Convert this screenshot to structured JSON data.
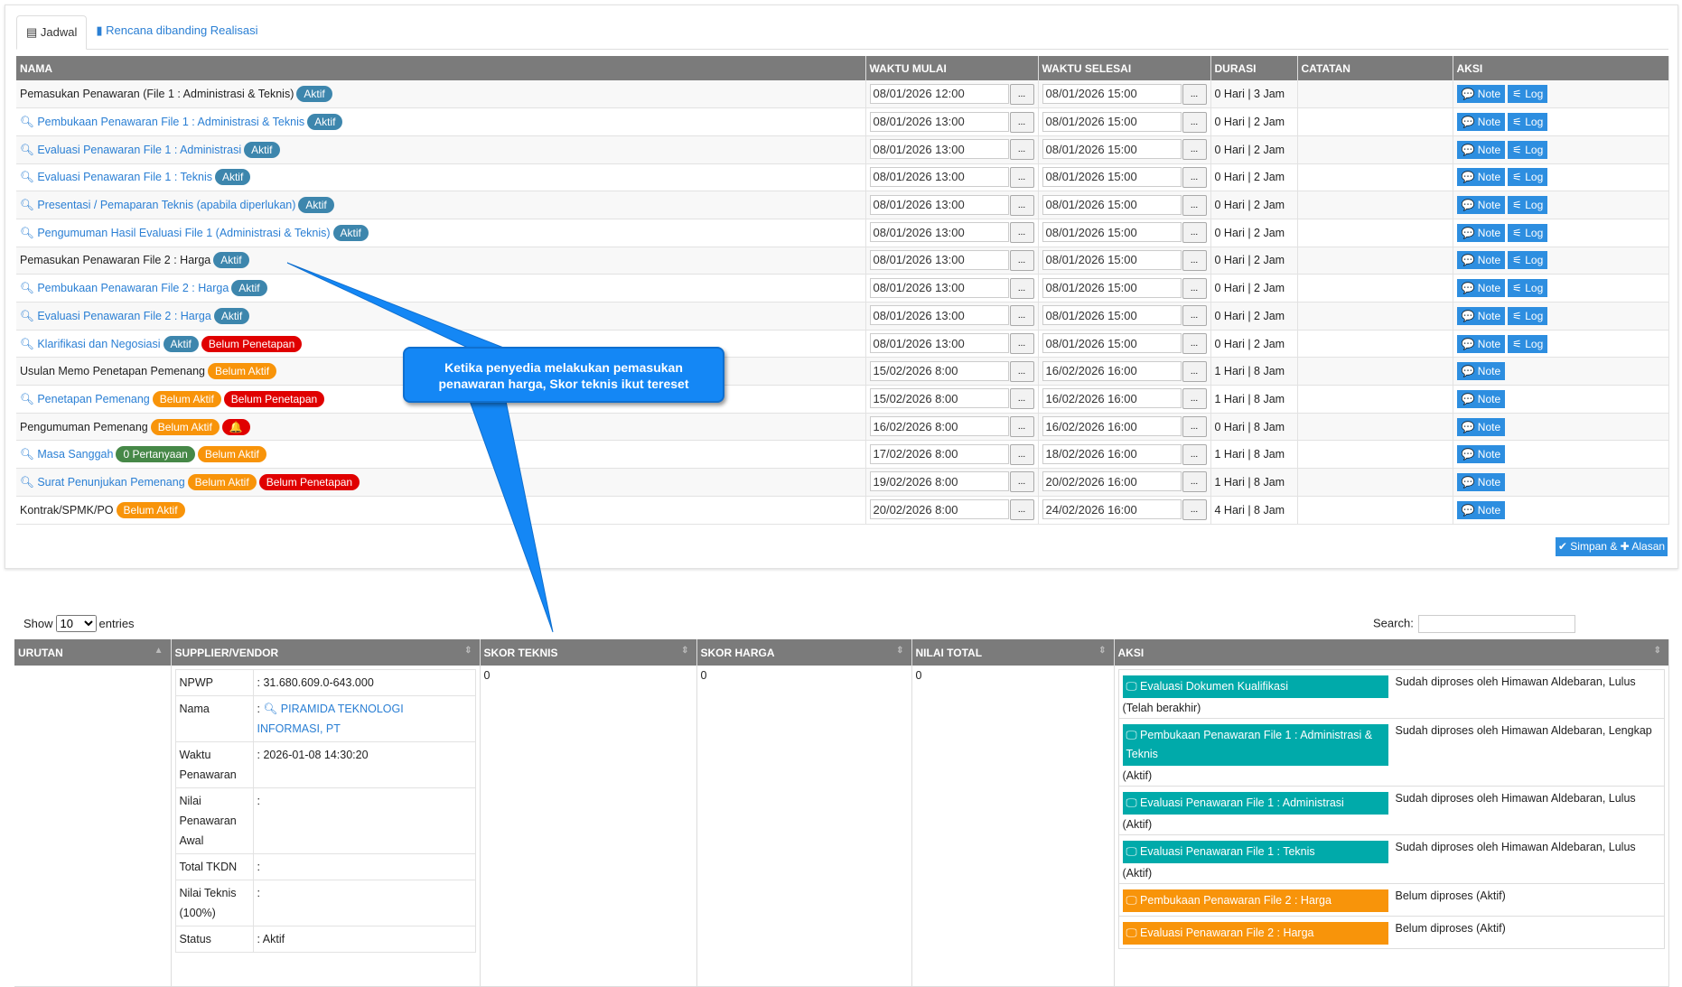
{
  "tabs": {
    "jadwal": "Jadwal",
    "rencana": "Rencana dibanding Realisasi"
  },
  "schedule": {
    "headers": [
      "NAMA",
      "WAKTU MULAI",
      "WAKTU SELESAI",
      "DURASI",
      "CATATAN",
      "AKSI"
    ],
    "note_label": "Note",
    "log_label": "Log",
    "picker_label": "...",
    "rows": [
      {
        "name": "Pemasukan Penawaran (File 1 : Administrasi & Teknis)",
        "link": false,
        "badges": [
          {
            "t": "Aktif",
            "c": "aktif"
          }
        ],
        "start": "08/01/2026 12:00",
        "end": "08/01/2026 15:00",
        "dur": "0 Hari | 3 Jam",
        "log": true
      },
      {
        "name": "Pembukaan Penawaran File 1 : Administrasi & Teknis",
        "link": true,
        "badges": [
          {
            "t": "Aktif",
            "c": "aktif"
          }
        ],
        "start": "08/01/2026 13:00",
        "end": "08/01/2026 15:00",
        "dur": "0 Hari | 2 Jam",
        "log": true
      },
      {
        "name": "Evaluasi Penawaran File 1 : Administrasi",
        "link": true,
        "badges": [
          {
            "t": "Aktif",
            "c": "aktif"
          }
        ],
        "start": "08/01/2026 13:00",
        "end": "08/01/2026 15:00",
        "dur": "0 Hari | 2 Jam",
        "log": true
      },
      {
        "name": "Evaluasi Penawaran File 1 : Teknis",
        "link": true,
        "badges": [
          {
            "t": "Aktif",
            "c": "aktif"
          }
        ],
        "start": "08/01/2026 13:00",
        "end": "08/01/2026 15:00",
        "dur": "0 Hari | 2 Jam",
        "log": true
      },
      {
        "name": "Presentasi / Pemaparan Teknis (apabila diperlukan)",
        "link": true,
        "badges": [
          {
            "t": "Aktif",
            "c": "aktif"
          }
        ],
        "start": "08/01/2026 13:00",
        "end": "08/01/2026 15:00",
        "dur": "0 Hari | 2 Jam",
        "log": true
      },
      {
        "name": "Pengumuman Hasil Evaluasi File 1 (Administrasi & Teknis)",
        "link": true,
        "badges": [
          {
            "t": "Aktif",
            "c": "aktif"
          }
        ],
        "start": "08/01/2026 13:00",
        "end": "08/01/2026 15:00",
        "dur": "0 Hari | 2 Jam",
        "log": true
      },
      {
        "name": "Pemasukan Penawaran File 2 : Harga",
        "link": false,
        "badges": [
          {
            "t": "Aktif",
            "c": "aktif"
          }
        ],
        "start": "08/01/2026 13:00",
        "end": "08/01/2026 15:00",
        "dur": "0 Hari | 2 Jam",
        "log": true
      },
      {
        "name": "Pembukaan Penawaran File 2 : Harga",
        "link": true,
        "badges": [
          {
            "t": "Aktif",
            "c": "aktif"
          }
        ],
        "start": "08/01/2026 13:00",
        "end": "08/01/2026 15:00",
        "dur": "0 Hari | 2 Jam",
        "log": true
      },
      {
        "name": "Evaluasi Penawaran File 2 : Harga",
        "link": true,
        "badges": [
          {
            "t": "Aktif",
            "c": "aktif"
          }
        ],
        "start": "08/01/2026 13:00",
        "end": "08/01/2026 15:00",
        "dur": "0 Hari | 2 Jam",
        "log": true
      },
      {
        "name": "Klarifikasi dan Negosiasi",
        "link": true,
        "badges": [
          {
            "t": "Aktif",
            "c": "aktif"
          },
          {
            "t": "Belum Penetapan",
            "c": "red"
          }
        ],
        "start": "08/01/2026 13:00",
        "end": "08/01/2026 15:00",
        "dur": "0 Hari | 2 Jam",
        "log": true
      },
      {
        "name": "Usulan Memo Penetapan Pemenang",
        "link": false,
        "badges": [
          {
            "t": "Belum Aktif",
            "c": "orange"
          }
        ],
        "start": "15/02/2026 8:00",
        "end": "16/02/2026 16:00",
        "dur": "1 Hari | 8 Jam",
        "log": false
      },
      {
        "name": "Penetapan Pemenang",
        "link": true,
        "badges": [
          {
            "t": "Belum Aktif",
            "c": "orange"
          },
          {
            "t": "Belum Penetapan",
            "c": "red"
          }
        ],
        "start": "15/02/2026 8:00",
        "end": "16/02/2026 16:00",
        "dur": "1 Hari | 8 Jam",
        "log": false
      },
      {
        "name": "Pengumuman Pemenang",
        "link": false,
        "badges": [
          {
            "t": "Belum Aktif",
            "c": "orange"
          },
          {
            "t": "🔔",
            "c": "red"
          }
        ],
        "start": "16/02/2026 8:00",
        "end": "16/02/2026 16:00",
        "dur": "0 Hari | 8 Jam",
        "log": false
      },
      {
        "name": "Masa Sanggah",
        "link": true,
        "badges": [
          {
            "t": "0 Pertanyaan",
            "c": "green"
          },
          {
            "t": "Belum Aktif",
            "c": "orange"
          }
        ],
        "start": "17/02/2026 8:00",
        "end": "18/02/2026 16:00",
        "dur": "1 Hari | 8 Jam",
        "log": false
      },
      {
        "name": "Surat Penunjukan Pemenang",
        "link": true,
        "badges": [
          {
            "t": "Belum Aktif",
            "c": "orange"
          },
          {
            "t": "Belum Penetapan",
            "c": "red"
          }
        ],
        "start": "19/02/2026 8:00",
        "end": "20/02/2026 16:00",
        "dur": "1 Hari | 8 Jam",
        "log": false
      },
      {
        "name": "Kontrak/SPMK/PO",
        "link": false,
        "badges": [
          {
            "t": "Belum Aktif",
            "c": "orange"
          }
        ],
        "start": "20/02/2026 8:00",
        "end": "24/02/2026 16:00",
        "dur": "4 Hari | 8 Jam",
        "log": false
      }
    ],
    "save_label": "Simpan & ✚ Alasan"
  },
  "colors": {
    "aktif": "#3d86ad",
    "orange": "#f8940a",
    "red": "#e00000",
    "green": "#468847",
    "teal": "#00aaaa",
    "blue": "#2d8ee0"
  },
  "callout": {
    "text1": "Ketika penyedia melakukan pemasukan",
    "text2": "penawaran harga, Skor teknis ikut tereset"
  },
  "results": {
    "show": "Show",
    "entries": "entries",
    "length": "10",
    "search": "Search:",
    "headers": [
      "URUTAN",
      "SUPPLIER/VENDOR",
      "SKOR TEKNIS",
      "SKOR HARGA",
      "NILAI TOTAL",
      "AKSI"
    ],
    "vendor": [
      {
        "k": "NPWP",
        "v": "31.680.609.0-643.000"
      },
      {
        "k": "Nama",
        "v": "PIRAMIDA TEKNOLOGI INFORMASI, PT",
        "link": true
      },
      {
        "k": "Waktu Penawaran",
        "v": "2026-01-08 14:30:20"
      },
      {
        "k": "Nilai Penawaran Awal",
        "v": ""
      },
      {
        "k": "Total TKDN",
        "v": ""
      },
      {
        "k": "Nilai Teknis (100%)",
        "v": ""
      },
      {
        "k": "Status",
        "v": "Aktif"
      }
    ],
    "skor_teknis": "0",
    "skor_harga": "0",
    "nilai_total": "0",
    "aksi": [
      {
        "label": "Evaluasi Dokumen Kualifikasi",
        "c": "teal",
        "status": "Sudah diproses oleh Himawan Aldebaran, Lulus",
        "sub": "(Telah berakhir)"
      },
      {
        "label": "Pembukaan Penawaran File 1 : Administrasi & Teknis",
        "c": "teal",
        "status": "Sudah diproses oleh Himawan Aldebaran, Lengkap",
        "sub": "(Aktif)"
      },
      {
        "label": "Evaluasi Penawaran File 1 : Administrasi",
        "c": "teal",
        "status": "Sudah diproses oleh Himawan Aldebaran, Lulus",
        "sub": "(Aktif)"
      },
      {
        "label": "Evaluasi Penawaran File 1 : Teknis",
        "c": "teal",
        "status": "Sudah diproses oleh Himawan Aldebaran, Lulus",
        "sub": "(Aktif)"
      },
      {
        "label": "Pembukaan Penawaran File 2 : Harga",
        "c": "orange",
        "status": "Belum diproses (Aktif)",
        "sub": ""
      },
      {
        "label": "Evaluasi Penawaran File 2 : Harga",
        "c": "orange",
        "status": "Belum diproses (Aktif)",
        "sub": ""
      }
    ]
  }
}
